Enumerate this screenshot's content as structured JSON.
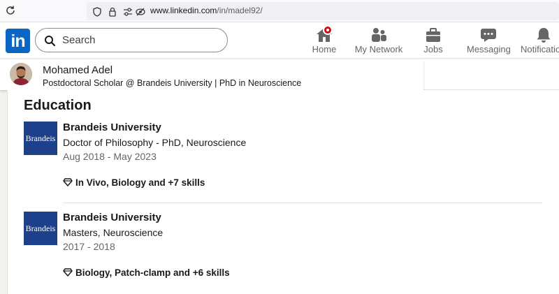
{
  "browser": {
    "url_host": "www.linkedin.com",
    "url_path": "/in/madel92/"
  },
  "nav": {
    "logo": "in",
    "search_placeholder": "Search",
    "items": [
      {
        "label": "Home",
        "icon": "home-icon"
      },
      {
        "label": "My Network",
        "icon": "network-icon"
      },
      {
        "label": "Jobs",
        "icon": "briefcase-icon"
      },
      {
        "label": "Messaging",
        "icon": "messaging-icon"
      },
      {
        "label": "Notifications",
        "icon": "bell-icon"
      }
    ],
    "accent": "#0a66c2",
    "badge_color": "#cc1016"
  },
  "profile": {
    "name": "Mohamed Adel",
    "headline": "Postdoctoral Scholar @ Brandeis University | PhD in Neuroscience"
  },
  "education": {
    "title": "Education",
    "entries": [
      {
        "logo_text": "Brandeis",
        "school": "Brandeis University",
        "degree": "Doctor of Philosophy - PhD, Neuroscience",
        "dates": "Aug 2018 - May 2023",
        "skills": "In Vivo, Biology and +7 skills"
      },
      {
        "logo_text": "Brandeis",
        "school": "Brandeis University",
        "degree": "Masters, Neuroscience",
        "dates": "2017 - 2018",
        "skills": "Biology, Patch-clamp and +6 skills"
      }
    ]
  }
}
